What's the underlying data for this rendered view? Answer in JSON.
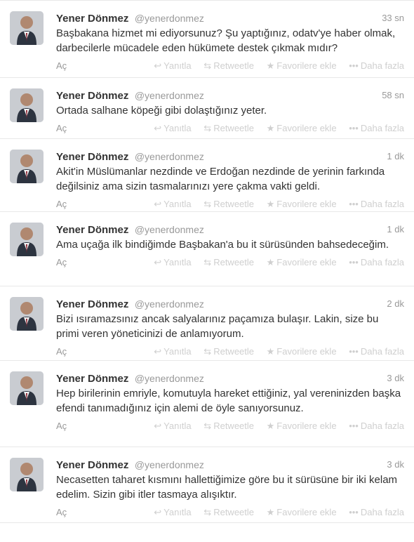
{
  "tweets": [
    {
      "fullname": "Yener Dönmez",
      "username": "@yenerdonmez",
      "time": "33 sn",
      "text": "Başbakana hizmet mi ediyorsunuz? Şu yaptığınız, odatv'ye haber olmak, darbecilerle mücadele eden hükümete destek çıkmak mıdır?",
      "expand": "Aç"
    },
    {
      "fullname": "Yener Dönmez",
      "username": "@yenerdonmez",
      "time": "58 sn",
      "text": "Ortada salhane köpeği gibi dolaştığınız yeter.",
      "expand": "Aç"
    },
    {
      "fullname": "Yener Dönmez",
      "username": "@yenerdonmez",
      "time": "1 dk",
      "text": "Akit'in Müslümanlar nezdinde ve Erdoğan nezdinde de yerinin farkında değilsiniz ama sizin tasmalarınızı yere çakma vakti geldi.",
      "expand": "Aç"
    },
    {
      "fullname": "Yener Dönmez",
      "username": "@yenerdonmez",
      "time": "1 dk",
      "text": "Ama uçağa ilk bindiğimde Başbakan'a bu it sürüsünden bahsedeceğim.",
      "expand": "Aç"
    },
    {
      "fullname": "Yener Dönmez",
      "username": "@yenerdonmez",
      "time": "2 dk",
      "text": "Bizi ısıramazsınız ancak salyalarınız paçamıza bulaşır. Lakin, size bu primi veren yöneticinizi de anlamıyorum.",
      "expand": "Aç"
    },
    {
      "fullname": "Yener Dönmez",
      "username": "@yenerdonmez",
      "time": "3 dk",
      "text": "Hep birilerinin emriyle, komutuyla hareket ettiğiniz, yal vereninizden başka efendi tanımadığınız için alemi de öyle sanıyorsunuz.",
      "expand": "Aç"
    },
    {
      "fullname": "Yener Dönmez",
      "username": "@yenerdonmez",
      "time": "3 dk",
      "text": "Necasetten taharet kısmını hallettiğimize göre bu it sürüsüne bir iki kelam edelim. Sizin gibi itler tasmaya alışıktır.",
      "expand": "Aç"
    }
  ],
  "actions": {
    "reply": "Yanıtla",
    "retweet": "Retweetle",
    "favorite": "Favorilere ekle",
    "more": "Daha fazla"
  },
  "icons": {
    "reply": "reply-arrow-icon",
    "retweet": "retweet-arrows-icon",
    "favorite": "star-icon",
    "more": "ellipsis-icon"
  }
}
